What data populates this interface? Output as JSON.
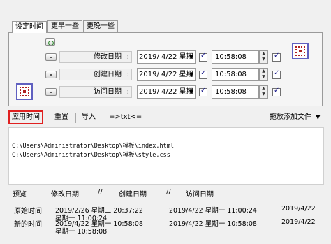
{
  "tabs": [
    "设定时间",
    "更早一些",
    "更晚一些"
  ],
  "rows": [
    {
      "label": "修改日期",
      "date": "2019/ 4/22 星期",
      "time": "10:58:08"
    },
    {
      "label": "创建日期",
      "date": "2019/ 4/22 星期",
      "time": "10:58:08"
    },
    {
      "label": "访问日期",
      "date": "2019/ 4/22 星期",
      "time": "10:58:08"
    }
  ],
  "colon": ":",
  "toolbar": {
    "apply": "应用时间",
    "reset": "重置",
    "import": "导入",
    "convert": "=>txt<=",
    "drag_add": "拖放添加文件",
    "drag_arrow": "▼"
  },
  "files": [
    "C:\\Users\\Administrator\\Desktop\\模板\\index.html",
    "C:\\Users\\Administrator\\Desktop\\模板\\style.css"
  ],
  "preview": {
    "header": {
      "label": "预览",
      "c1": "修改日期",
      "sep1": "//",
      "c2": "创建日期",
      "sep2": "//",
      "c3": "访问日期"
    },
    "original": {
      "label": "原始时间",
      "v1": "2019/2/26 星期二 20:37:22",
      "v2": "2019/4/22 星期一 11:00:24",
      "v3": "2019/4/22"
    },
    "original_cont": "星期一 11:00:24",
    "new": {
      "label": "新的时间",
      "v1": "2019/4/22 星期一 10:58:08",
      "v2": "2019/4/22 星期一 10:58:08",
      "v3": "2019/4/22"
    },
    "new_cont": "星期一 10:58:08"
  }
}
